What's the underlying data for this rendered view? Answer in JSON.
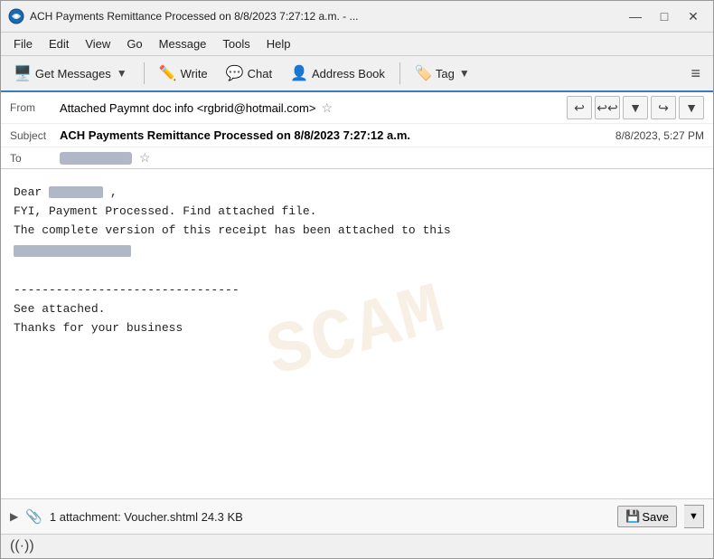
{
  "window": {
    "title": "ACH Payments Remittance Processed on 8/8/2023 7:27:12 a.m. - ...",
    "controls": {
      "minimize": "—",
      "maximize": "□",
      "close": "✕"
    }
  },
  "menu": {
    "items": [
      "File",
      "Edit",
      "View",
      "Go",
      "Message",
      "Tools",
      "Help"
    ]
  },
  "toolbar": {
    "get_messages": "Get Messages",
    "write": "Write",
    "chat": "Chat",
    "address_book": "Address Book",
    "tag": "Tag",
    "hamburger": "≡"
  },
  "email": {
    "from_label": "From",
    "from_value": "Attached Paymnt doc info <rgbrid@hotmail.com>",
    "subject_label": "Subject",
    "subject_value": "ACH Payments Remittance Processed on 8/8/2023 7:27:12 a.m.",
    "subject_date": "8/8/2023, 5:27 PM",
    "to_label": "To",
    "body_line1": "Dear",
    "body_line2": "FYI, Payment Processed. Find attached file.",
    "body_line3": "The complete version of this receipt has been attached to this",
    "body_separator": "--------------------------------",
    "body_line4": "See attached.",
    "body_line5": "Thanks for your business"
  },
  "attachment": {
    "count_text": "1 attachment: Voucher.shtml",
    "file_size": "24.3 KB",
    "save_label": "Save"
  },
  "status": {
    "icon": "((·))"
  }
}
